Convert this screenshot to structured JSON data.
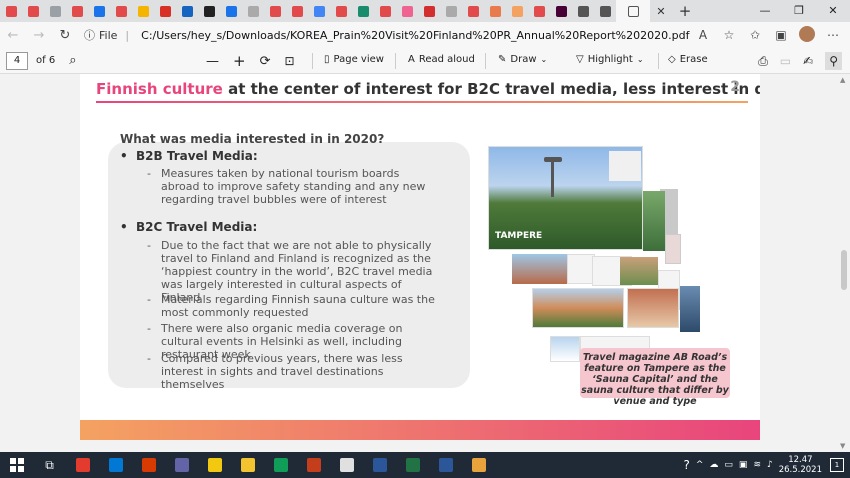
{
  "browser": {
    "tab_favicons": [
      "#e24b4b",
      "#e24b4b",
      "#9aa0a6",
      "#e24b4b",
      "#1a73e8",
      "#e24b4b",
      "#f4b400",
      "#d93025",
      "#1565c0",
      "#222222",
      "#1a73e8",
      "#aaaaaa",
      "#e24b4b",
      "#e24b4b",
      "#4285f4",
      "#e24b4b",
      "#1a8c6e",
      "#e24b4b",
      "#f06292",
      "#d32f2f",
      "#aaaaaa",
      "#e24b4b",
      "#e87a4b",
      "#f4a261",
      "#e24b4b",
      "#470137",
      "#555555",
      "#555555"
    ],
    "new_tab_label": "+",
    "minimize": "—",
    "restore": "❐",
    "close": "✕",
    "file_label": "File",
    "url": "C:/Users/hey_s/Downloads/KOREA_Prain%20Visit%20Finland%20PR_Annual%20Report%202020.pdf"
  },
  "pdf_toolbar": {
    "page": "4",
    "of_pages": "of 6",
    "zoom_out": "—",
    "zoom_in": "+",
    "page_view": "Page view",
    "read_aloud": "Read aloud",
    "draw": "Draw",
    "highlight": "Highlight",
    "erase": "Erase"
  },
  "slide": {
    "title_highlight": "Finnish culture",
    "title_rest": " at the center of interest for B2C travel media, less interest in destinations",
    "page_number": "2",
    "question": "What was media interested in in 2020?",
    "b2b_heading": "B2B Travel Media:",
    "b2b_items": [
      "Measures taken by national tourism boards abroad to improve safety standing and any new regarding travel bubbles were of interest"
    ],
    "b2c_heading": "B2C Travel Media:",
    "b2c_items": [
      "Due to the fact that we are not able to physically travel to Finland and Finland is recognized as the ‘happiest country in the world’, B2C travel media was largely interested in cultural aspects of Finland",
      "Materials regarding Finnish sauna culture was the most commonly requested",
      "There were also organic media coverage on cultural events in Helsinki as well, including restaurant week",
      "Compared to previous years, there was less interest in sights and travel destinations themselves"
    ],
    "image_label": "TAMPERE",
    "caption": "Travel magazine AB Road’s feature on Tampere as the ‘Sauna Capital’ and the sauna culture that differ by venue and type"
  },
  "taskbar": {
    "apps": [
      "#e33b2e",
      "#0078d4",
      "#d83b01",
      "#6264a7",
      "#f2c811",
      "#f4c430",
      "#0f9d58",
      "#c43e1c",
      "#e0e0e0",
      "#2b579a",
      "#217346",
      "#2b579a",
      "#e8a33c"
    ],
    "time": "12.47",
    "date": "26.5.2021",
    "notifications": "1"
  }
}
